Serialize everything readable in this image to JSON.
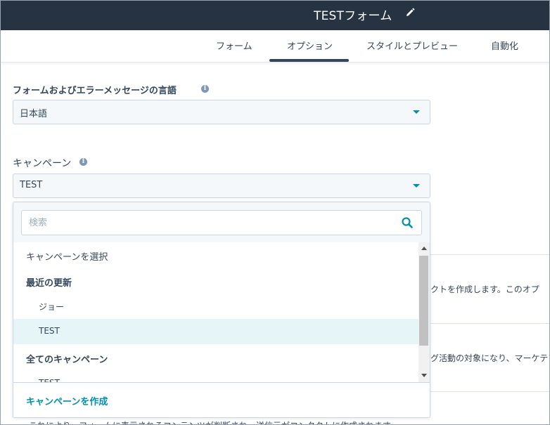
{
  "header": {
    "title": "TESTフォーム"
  },
  "tabs": [
    {
      "label": "フォーム"
    },
    {
      "label": "オプション",
      "active": true
    },
    {
      "label": "スタイルとプレビュー"
    },
    {
      "label": "自動化"
    }
  ],
  "language": {
    "label": "フォームおよびエラーメッセージの言語",
    "value": "日本語"
  },
  "campaign": {
    "label": "キャンペーン",
    "value": "TEST"
  },
  "dropdown": {
    "search_placeholder": "検索",
    "items": [
      {
        "label": "キャンペーンを選択",
        "type": "option"
      },
      {
        "label": "最近の更新",
        "type": "header"
      },
      {
        "label": "ジョー",
        "type": "child"
      },
      {
        "label": "TEST",
        "type": "child",
        "selected": true
      },
      {
        "label": "全てのキャンペーン",
        "type": "header"
      },
      {
        "label": "TEST",
        "type": "child"
      }
    ],
    "create_label": "キャンペーンを作成"
  },
  "background": {
    "row1": "クトを作成します。このオプ",
    "row2": "グ活動の対象になり、マーケテ",
    "row3": "これにより、フォームに表示されるコンテンツが判断され、送信元がコンタクトに作成されます"
  },
  "colors": {
    "topbar": "#253342",
    "accent": "#0091ae",
    "text": "#33475b"
  }
}
